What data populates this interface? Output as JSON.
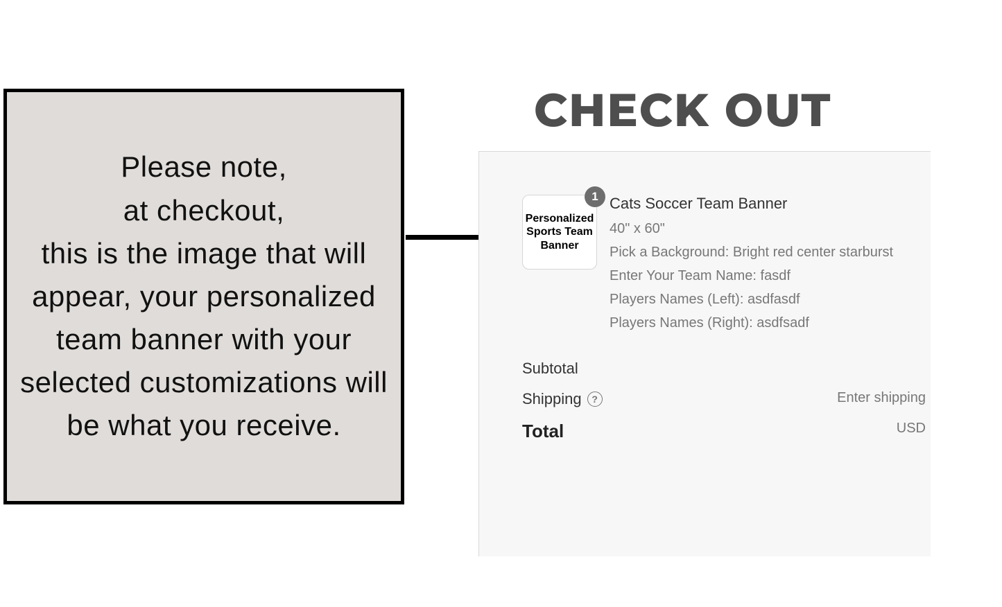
{
  "note": {
    "text": "Please note,\nat checkout,\nthis is the image that will appear, your personalized team banner  with your selected customizations will be what you receive."
  },
  "heading": "CHECK OUT",
  "cart": {
    "item": {
      "qty": "1",
      "thumb_line1": "Personalized",
      "thumb_line2": "Sports Team",
      "thumb_line3": "Banner",
      "title": "Cats Soccer Team Banner",
      "size": "40\" x 60\"",
      "background": "Pick a Background: Bright red center starburst",
      "team_name": "Enter Your Team Name: fasdf",
      "players_left": "Players Names (Left): asdfasdf",
      "players_right": "Players Names (Right): asdfsadf"
    },
    "subtotal_label": "Subtotal",
    "shipping_label": "Shipping",
    "shipping_value": "Enter shipping",
    "total_label": "Total",
    "total_currency": "USD",
    "help_icon_text": "?"
  }
}
